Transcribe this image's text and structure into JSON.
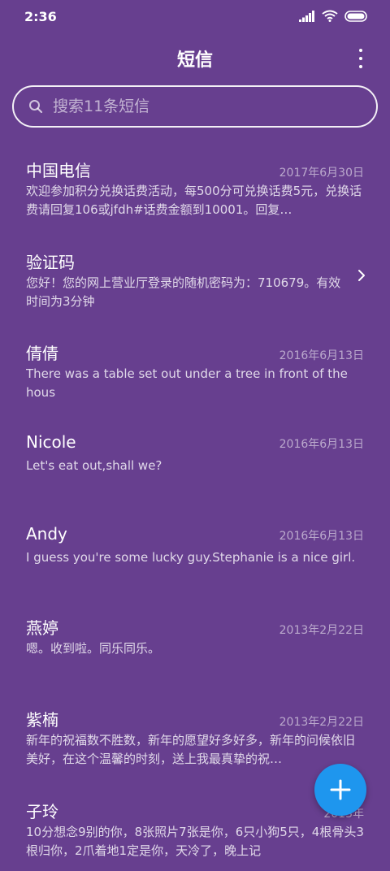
{
  "status_bar": {
    "time": "2:36"
  },
  "header": {
    "title": "短信"
  },
  "search": {
    "placeholder": "搜索11条短信"
  },
  "conversations": [
    {
      "name": "中国电信",
      "date": "2017年6月30日",
      "preview": "欢迎参加积分兑换话费活动，每500分可兑换话费5元，兑换话费请回复106或jfdh#话费金额到10001。回复…"
    },
    {
      "name": "验证码",
      "date": "",
      "preview": "您好！您的网上营业厅登录的随机密码为：710679。有效时间为3分钟"
    },
    {
      "name": "倩倩",
      "date": "2016年6月13日",
      "preview": "There was a table set out under a tree in front of the hous"
    },
    {
      "name": "Nicole",
      "date": "2016年6月13日",
      "preview": "Let's eat out,shall we?"
    },
    {
      "name": "Andy",
      "date": "2016年6月13日",
      "preview": "I guess you're some lucky guy.Stephanie is a nice girl."
    },
    {
      "name": "燕婷",
      "date": "2013年2月22日",
      "preview": "嗯。收到啦。同乐同乐。"
    },
    {
      "name": "紫楠",
      "date": "2013年2月22日",
      "preview": "新年的祝福数不胜数，新年的愿望好多好多，新年的问候依旧美好，在这个温馨的时刻，送上我最真挚的祝…"
    },
    {
      "name": "子玲",
      "date": "2013年",
      "preview": "10分想念9别的你，8张照片7张是你，6只小狗5只，4根骨头3根归你，2爪着地1定是你，天冷了，晚上记"
    }
  ],
  "icons": {
    "search": "search-icon",
    "menu": "more-vert-icon",
    "chevron": "chevron-right-icon",
    "fab": "plus-icon",
    "signal": "signal-icon",
    "wifi": "wifi-icon",
    "battery": "battery-icon"
  },
  "colors": {
    "background": "#673f8f",
    "fab": "#1e96ee"
  }
}
